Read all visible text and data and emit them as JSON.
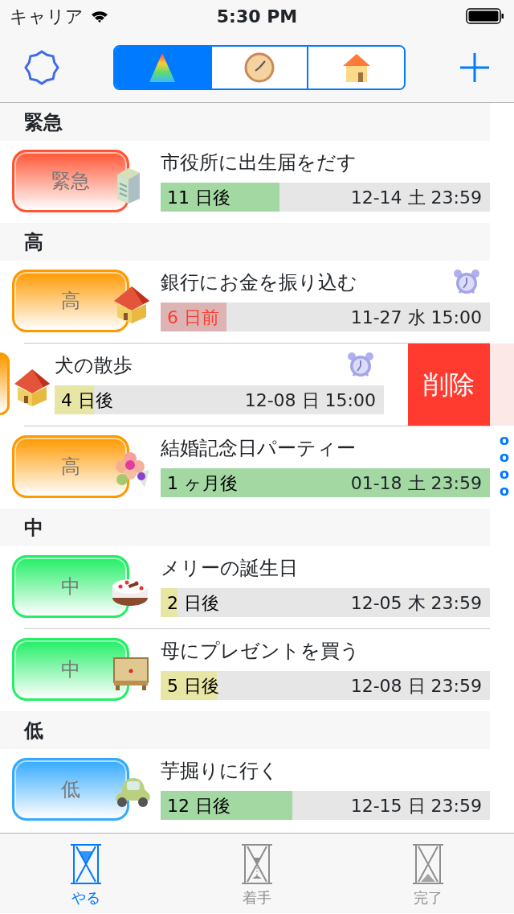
{
  "status_bar": {
    "carrier": "キャリア",
    "time": "5:30 PM"
  },
  "segments": [
    {
      "selected": true
    },
    {
      "selected": false
    },
    {
      "selected": false
    }
  ],
  "sections": [
    {
      "title": "緊急",
      "rows": [
        {
          "title": "市役所に出生届をだす",
          "kind": "building",
          "badge": {
            "label": "緊急",
            "color": "#ff5533"
          },
          "progress": {
            "text": "11 日後",
            "level": 0.36,
            "color": "#a3d8a3",
            "overdue": false
          },
          "due": "12-14 土 23:59",
          "alarm": false,
          "swiped": false
        }
      ]
    },
    {
      "title": "高",
      "rows": [
        {
          "title": "銀行にお金を振り込む",
          "kind": "house",
          "badge": {
            "label": "高",
            "color": "#ff9900"
          },
          "progress": {
            "text": "6 日前",
            "level": 0.2,
            "color": "#dcb4b4",
            "overdue": true
          },
          "due": "11-27 水 15:00",
          "alarm": true,
          "swiped": false
        },
        {
          "title": "犬の散歩",
          "kind": "house",
          "badge": {
            "color": "#ff9900"
          },
          "progress": {
            "text": "4 日後",
            "level": 0.12,
            "color": "#e8e6a4",
            "overdue": false
          },
          "due": "12-08 日 15:00",
          "alarm": true,
          "swiped": true,
          "delete_button": {
            "label": "削除"
          }
        },
        {
          "title": "結婚記念日パーティー",
          "kind": "flower",
          "badge": {
            "label": "高",
            "color": "#ff9900"
          },
          "progress": {
            "text": "1 ヶ月後",
            "level": 1,
            "color": "#a3d8a3",
            "overdue": false
          },
          "due": "01-18 土 23:59",
          "alarm": false,
          "swiped": false
        }
      ]
    },
    {
      "title": "中",
      "rows": [
        {
          "title": "メリーの誕生日",
          "kind": "cake",
          "badge": {
            "label": "中",
            "color": "#22ee66"
          },
          "progress": {
            "text": "2 日後",
            "level": 0.05,
            "color": "#e8e6a4",
            "overdue": false
          },
          "due": "12-05 木 23:59",
          "alarm": false,
          "swiped": false
        },
        {
          "title": "母にプレゼントを買う",
          "kind": "chest",
          "badge": {
            "label": "中",
            "color": "#22ee66"
          },
          "progress": {
            "text": "5 日後",
            "level": 0.17,
            "color": "#e8e6a4",
            "overdue": false
          },
          "due": "12-08 日 23:59",
          "alarm": false,
          "swiped": false
        }
      ]
    },
    {
      "title": "低",
      "rows": [
        {
          "title": "芋掘りに行く",
          "kind": "car",
          "badge": {
            "label": "低",
            "color": "#33aaff"
          },
          "progress": {
            "text": "12 日後",
            "level": 0.4,
            "color": "#a3d8a3",
            "overdue": false
          },
          "due": "12-15 日 23:59",
          "alarm": false,
          "swiped": false
        }
      ]
    }
  ],
  "index_marks": [
    "o",
    "o",
    "o",
    "o"
  ],
  "tab_bar": [
    {
      "label": "やる",
      "selected": true
    },
    {
      "label": "着手",
      "selected": false
    },
    {
      "label": "完了",
      "selected": false
    }
  ]
}
